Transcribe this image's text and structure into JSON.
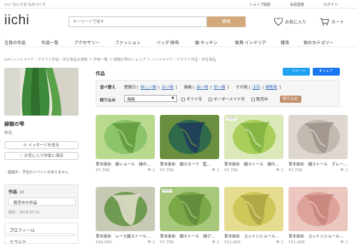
{
  "header": {
    "tagline": "いい ちいさな ものづくり",
    "links": [
      "ショップ開設",
      "会員登録",
      "ログイン"
    ],
    "logo": "iichi",
    "search_placeholder": "キーワードで探す",
    "search_button": "検索",
    "favorites": "お気に入り",
    "cart": "カート"
  },
  "nav": [
    "注目の作品",
    "作品一覧",
    "アクセサリー",
    "ファッション",
    "バッグ·財布",
    "器·キッチン",
    "家具·インテリア",
    "雑貨",
    "他のカテゴリー"
  ],
  "breadcrumb": "iichi ハンドメイド・クラフト作品・手仕事品の通販 ＞ 作家一覧 ＞ 緑樹の雫のショップ ＞ ハンドメイド・クラフト作品・手仕事品",
  "shop": {
    "name": "緑樹の雫",
    "prefecture": "群馬",
    "message_button": "メッセージを送る",
    "save_button": "お気に入り作家に保存",
    "events": "・開催中・予定のイベントがありません"
  },
  "sidebar": {
    "works_label": "作品",
    "works_count": "18",
    "on_sale": "販売中の作品",
    "opened": "開店：2019.07.21",
    "profile": "プロフィール",
    "events": "イベント"
  },
  "main": {
    "title": "作品",
    "tweet": "ツイート",
    "share": "シェア",
    "sort": {
      "label": "並べ替え",
      "groups": [
        {
          "name": "登録日",
          "options": [
            "新しい順",
            "古い順"
          ]
        },
        {
          "name": "価格",
          "options": [
            "高い順",
            "安い順"
          ]
        },
        {
          "name": "その他",
          "options": [
            "注目",
            "閲覧数"
          ]
        }
      ]
    },
    "narrow": {
      "label": "絞り込み",
      "select_value": "価格",
      "checks": [
        "ギフト可",
        "オーダーメイド可",
        "販売中"
      ],
      "button": "絞り込む"
    }
  },
  "products": [
    {
      "name": "草木染め　麻ショール　緑の…",
      "price": "¥7,700",
      "likes": "0",
      "sold": false,
      "colors": [
        "#5f9a3c",
        "#8bc46a",
        "#b9d98f"
      ]
    },
    {
      "name": "草木染め　絹スカーフ　藍…",
      "price": "¥7,700",
      "likes": "0",
      "sold": false,
      "colors": [
        "#1f3a5c",
        "#2f6a4a",
        "#6b8f3e"
      ]
    },
    {
      "name": "草木染め　絹ストール　緑の…",
      "price": "¥7,700",
      "likes": "0",
      "sold": true,
      "colors": [
        "#7fb240",
        "#a9cf5a",
        "#dbe9b8"
      ]
    },
    {
      "name": "草木染め　絹ストール　グレー…",
      "price": "¥7,700",
      "likes": "0",
      "sold": false,
      "colors": [
        "#9c928a",
        "#c2b9b0",
        "#ded7d0"
      ]
    },
    {
      "name": "草木染め　レース編ストール…",
      "price": "¥16,500",
      "likes": "0",
      "sold": false,
      "colors": [
        "#e8e2cf",
        "#6f9a52",
        "#c8c9b5"
      ]
    },
    {
      "name": "草木染め　絹ストール　緑グ…",
      "price": "¥7,700",
      "likes": "2",
      "sold": true,
      "colors": [
        "#5f8a3c",
        "#7ba947",
        "#a7c77a"
      ]
    },
    {
      "name": "草木染め　コットンショール…",
      "price": "¥11,000",
      "likes": "0",
      "sold": false,
      "colors": [
        "#a8a243",
        "#cfc75a",
        "#e4dd90"
      ]
    },
    {
      "name": "草木染め　コットンショール…",
      "price": "¥11,000",
      "likes": "0",
      "sold": false,
      "colors": [
        "#c8847a",
        "#dda39a",
        "#ecc7c0"
      ]
    }
  ]
}
